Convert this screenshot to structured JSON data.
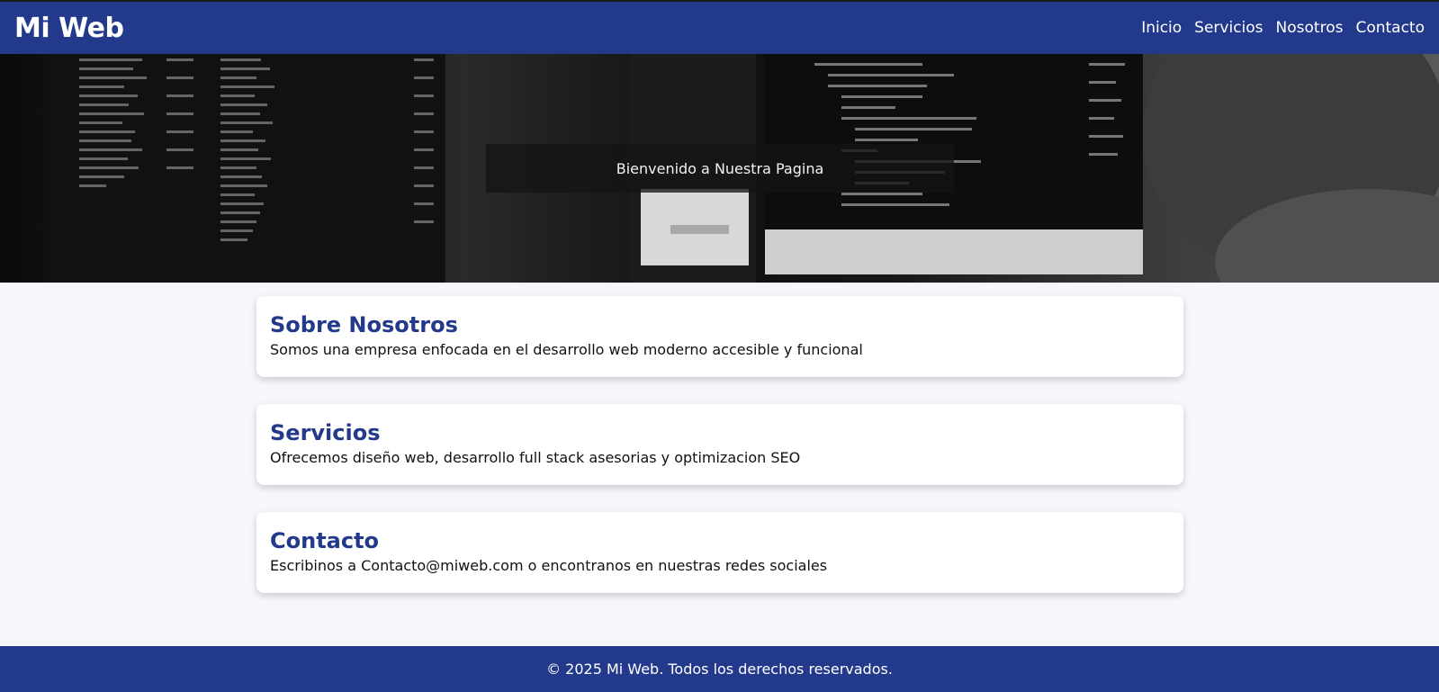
{
  "header": {
    "brand": "Mi Web",
    "nav": [
      "Inicio",
      "Servicios",
      "Nosotros",
      "Contacto"
    ]
  },
  "hero": {
    "title": "Bienvenido a Nuestra Pagina"
  },
  "sections": [
    {
      "title": "Sobre Nosotros",
      "text": "Somos una empresa enfocada en el desarrollo web moderno accesible y funcional"
    },
    {
      "title": "Servicios",
      "text": "Ofrecemos diseño web, desarrollo full stack asesorias y optimizacion SEO"
    },
    {
      "title": "Contacto",
      "text": "Escribinos a Contacto@miweb.com o encontranos en nuestras redes sociales"
    }
  ],
  "footer": {
    "text": "© 2025 Mi Web. Todos los derechos reservados."
  },
  "colors": {
    "primary": "#233a8c",
    "page_bg": "#f5f7fb",
    "card_bg": "#ffffff"
  }
}
